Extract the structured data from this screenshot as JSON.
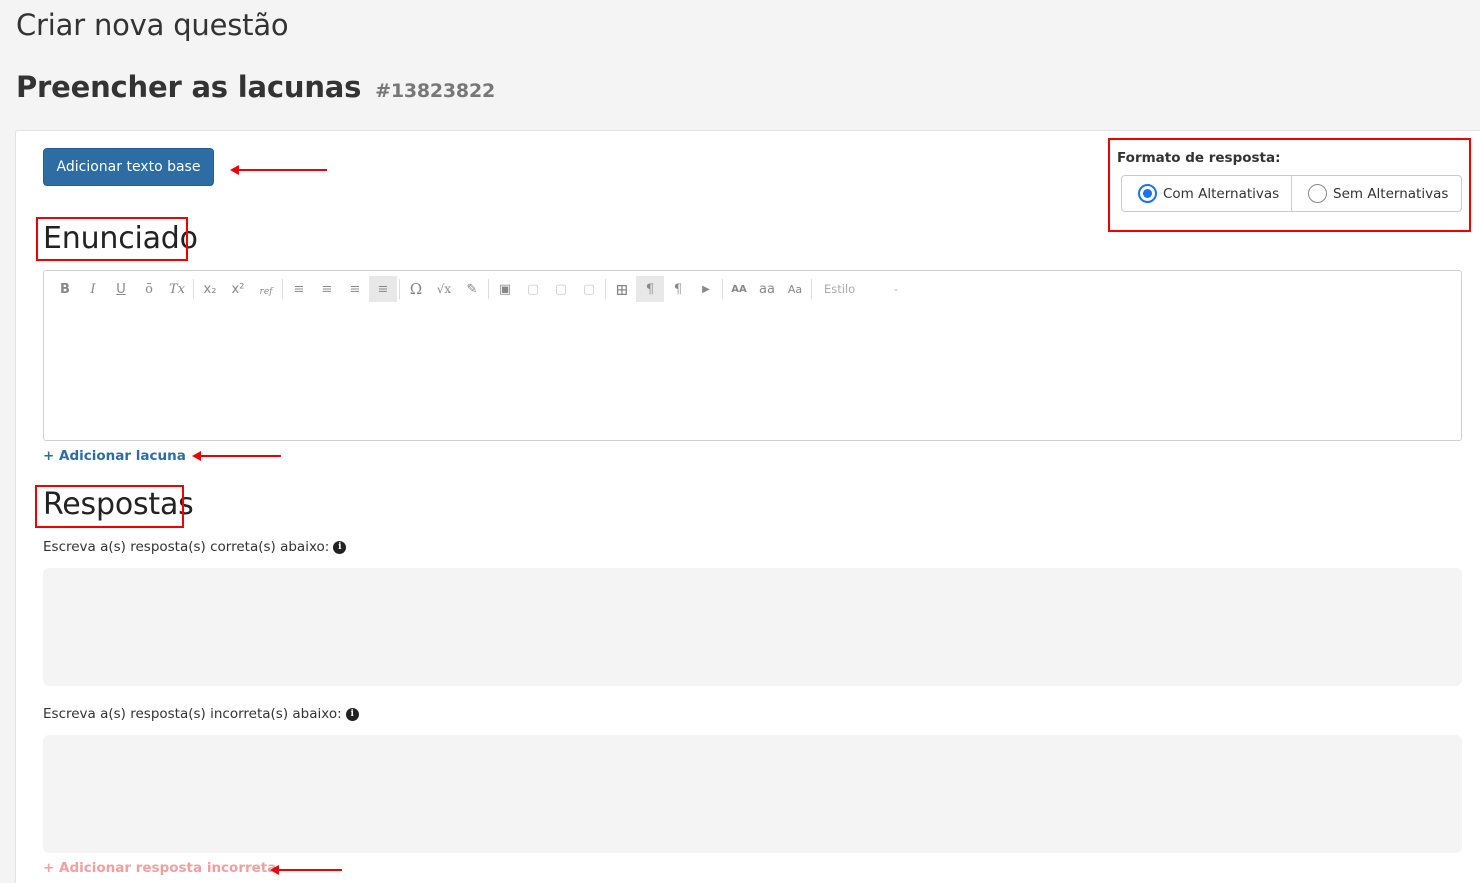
{
  "header": {
    "page_title": "Criar nova questão",
    "question_type": "Preencher as lacunas",
    "question_id": "#13823822"
  },
  "actions": {
    "add_base_text": "Adicionar texto base",
    "add_gap": "+ Adicionar lacuna",
    "add_incorrect": "+ Adicionar resposta incorreta"
  },
  "response_format": {
    "label": "Formato de resposta:",
    "options": [
      "Com Alternativas",
      "Sem Alternativas"
    ],
    "selected": "Com Alternativas"
  },
  "sections": {
    "statement": "Enunciado",
    "answers": "Respostas"
  },
  "editor": {
    "toolbar_glyphs": [
      "B",
      "I",
      "U",
      "ō",
      "Tx",
      "x₂",
      "x²",
      "ref",
      "≡",
      "≡",
      "≡",
      "≡",
      "Ω",
      "√x",
      "✎",
      "▣",
      "▢",
      "▢",
      "▢",
      "⊞",
      "¶",
      "¶",
      "▶",
      "AA",
      "aa",
      "Aa"
    ],
    "style_label": "Estilo",
    "style_caret": "-"
  },
  "answers": {
    "correct_label": "Escreva a(s) resposta(s) correta(s) abaixo:",
    "incorrect_label": "Escreva a(s) resposta(s) incorreta(s) abaixo:",
    "info_glyph": "i"
  },
  "colors": {
    "primary": "#2e6da4",
    "annotation_red": "#e00000",
    "radio_blue": "#1a73e8"
  }
}
